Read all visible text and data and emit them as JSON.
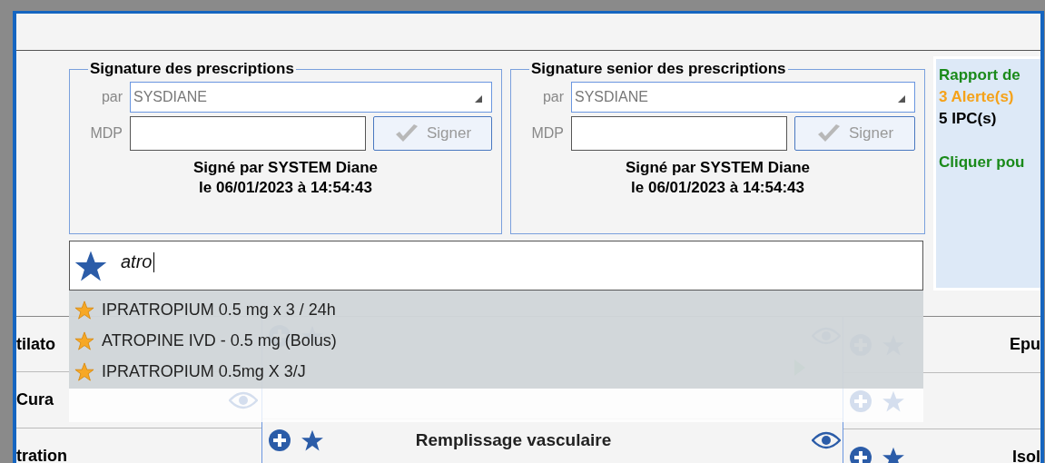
{
  "signatures": [
    {
      "title": "Signature des prescriptions",
      "par_label": "par",
      "user": "SYSDIANE",
      "mdp_label": "MDP",
      "sign_button": {
        "label": "Signer",
        "disabled": true
      },
      "signed_line1": "Signé par SYSTEM Diane",
      "signed_line2": "le 06/01/2023 à 14:54:43"
    },
    {
      "title": "Signature senior des prescriptions",
      "par_label": "par",
      "user": "SYSDIANE",
      "mdp_label": "MDP",
      "sign_button": {
        "label": "Signer",
        "disabled": true
      },
      "signed_line1": "Signé par SYSTEM Diane",
      "signed_line2": "le 06/01/2023 à 14:54:43"
    }
  ],
  "report": [
    {
      "text": "Rapport de",
      "kind": "title"
    },
    {
      "text": "3 Alerte(s)",
      "kind": "alert"
    },
    {
      "text": "5 IPC(s)",
      "kind": "count"
    },
    {
      "text": "Cliquer pou",
      "kind": "link"
    }
  ],
  "search": {
    "value": "atro"
  },
  "suggestions": [
    {
      "label": "IPRATROPIUM 0.5 mg x 3 / 24h"
    },
    {
      "label": "ATROPINE IVD - 0.5 mg (Bolus)"
    },
    {
      "label": "IPRATROPIUM 0.5mg X 3/J"
    }
  ],
  "left_sections": [
    {
      "title": "tilato"
    },
    {
      "title": "Cura"
    },
    {
      "title": "tration"
    }
  ],
  "remplissage": {
    "title": "Remplissage vasculaire"
  },
  "right_sections": [
    {
      "kind": "titled",
      "title": "Epu"
    },
    {
      "kind": "blank"
    },
    {
      "kind": "titled",
      "title": "Isol"
    }
  ]
}
